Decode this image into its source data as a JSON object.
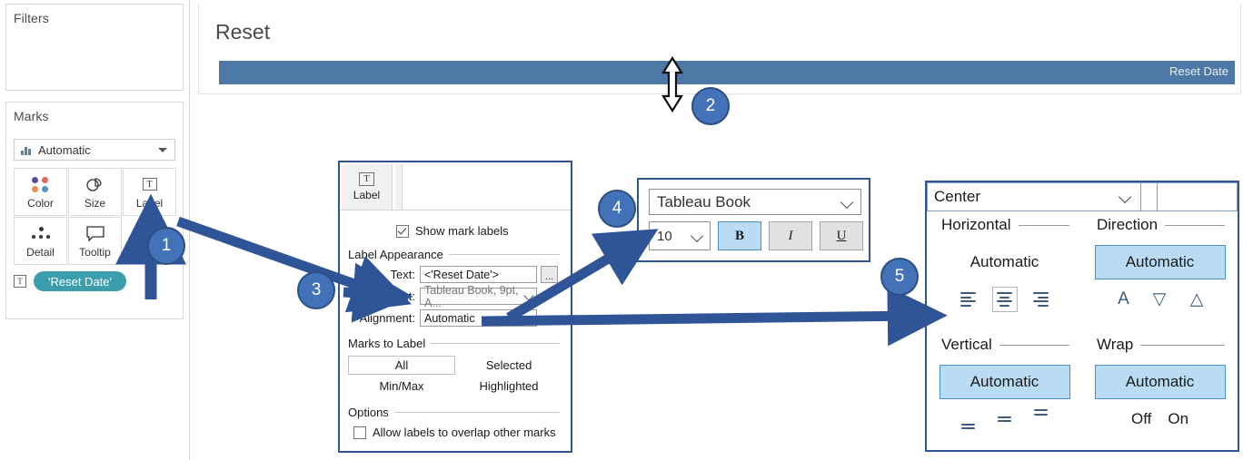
{
  "sidebar": {
    "filters_card": {
      "title": "Filters"
    },
    "marks_card": {
      "title": "Marks",
      "mark_type": "Automatic",
      "mark_type_icon": "bar-chart-icon",
      "shelves": [
        {
          "label": "Color",
          "icon": "color-dots-icon"
        },
        {
          "label": "Size",
          "icon": "size-shapes-icon"
        },
        {
          "label": "Label",
          "icon": "text-label-icon"
        },
        {
          "label": "Detail",
          "icon": "detail-dots-icon"
        },
        {
          "label": "Tooltip",
          "icon": "tooltip-bubble-icon"
        }
      ],
      "pill": {
        "label": "'Reset Date'",
        "icon": "text-field-icon",
        "color": "#3c9ead"
      }
    }
  },
  "view": {
    "title": "Reset",
    "bar_label": "Reset Date",
    "bar_color": "#4e79a7"
  },
  "badges": [
    {
      "number": "1"
    },
    {
      "number": "2"
    },
    {
      "number": "3"
    },
    {
      "number": "4"
    },
    {
      "number": "5"
    }
  ],
  "label_dialog": {
    "tab": {
      "label": "Label",
      "icon": "text-label-icon"
    },
    "show_mark_labels": {
      "label": "Show mark labels",
      "checked": true
    },
    "label_appearance": {
      "section": "Label Appearance",
      "text_label": "Text:",
      "text_value": "<'Reset Date'>",
      "text_ellipsis": "...",
      "font_label": "Font:",
      "font_value": "Tableau Book, 9pt, A...",
      "alignment_label": "Alignment:",
      "alignment_value": "Automatic"
    },
    "marks_to_label": {
      "section": "Marks to Label",
      "options": [
        "All",
        "Selected",
        "Min/Max",
        "Highlighted"
      ],
      "selected": "All"
    },
    "options": {
      "section": "Options",
      "overlap_label": "Allow labels to overlap other marks",
      "overlap_checked": false
    }
  },
  "font_popup": {
    "font_name": "Tableau Book",
    "font_size": "10",
    "bold": "B",
    "italic": "I",
    "underline": "U",
    "bold_active": true,
    "italic_active": false,
    "underline_active": false,
    "active_color": "#b9dcf4"
  },
  "align_popup": {
    "select_value": "Center",
    "horizontal": {
      "title": "Horizontal",
      "automatic": "Automatic",
      "auto_selected": false,
      "icons": [
        "align-left-icon",
        "align-center-icon",
        "align-right-icon"
      ],
      "selected_icon": "align-center-icon"
    },
    "direction": {
      "title": "Direction",
      "automatic": "Automatic",
      "auto_selected": true,
      "icons": [
        "text-horizontal-icon",
        "text-rotate-up-icon",
        "text-rotate-down-icon"
      ]
    },
    "vertical": {
      "title": "Vertical",
      "automatic": "Automatic",
      "auto_selected": true,
      "icons": [
        "valign-bottom-icon",
        "valign-middle-icon",
        "valign-top-icon"
      ]
    },
    "wrap": {
      "title": "Wrap",
      "automatic": "Automatic",
      "auto_selected": true,
      "off_label": "Off",
      "on_label": "On"
    }
  },
  "colors": {
    "accent_blue": "#4472b8",
    "badge_border": "#2c4f86",
    "dialog_border": "#2f5597",
    "arrow_blue": "#2f5597",
    "pill_teal": "#3c9ead",
    "bar_blue": "#4e79a7",
    "highlight": "#b9dcf4"
  }
}
